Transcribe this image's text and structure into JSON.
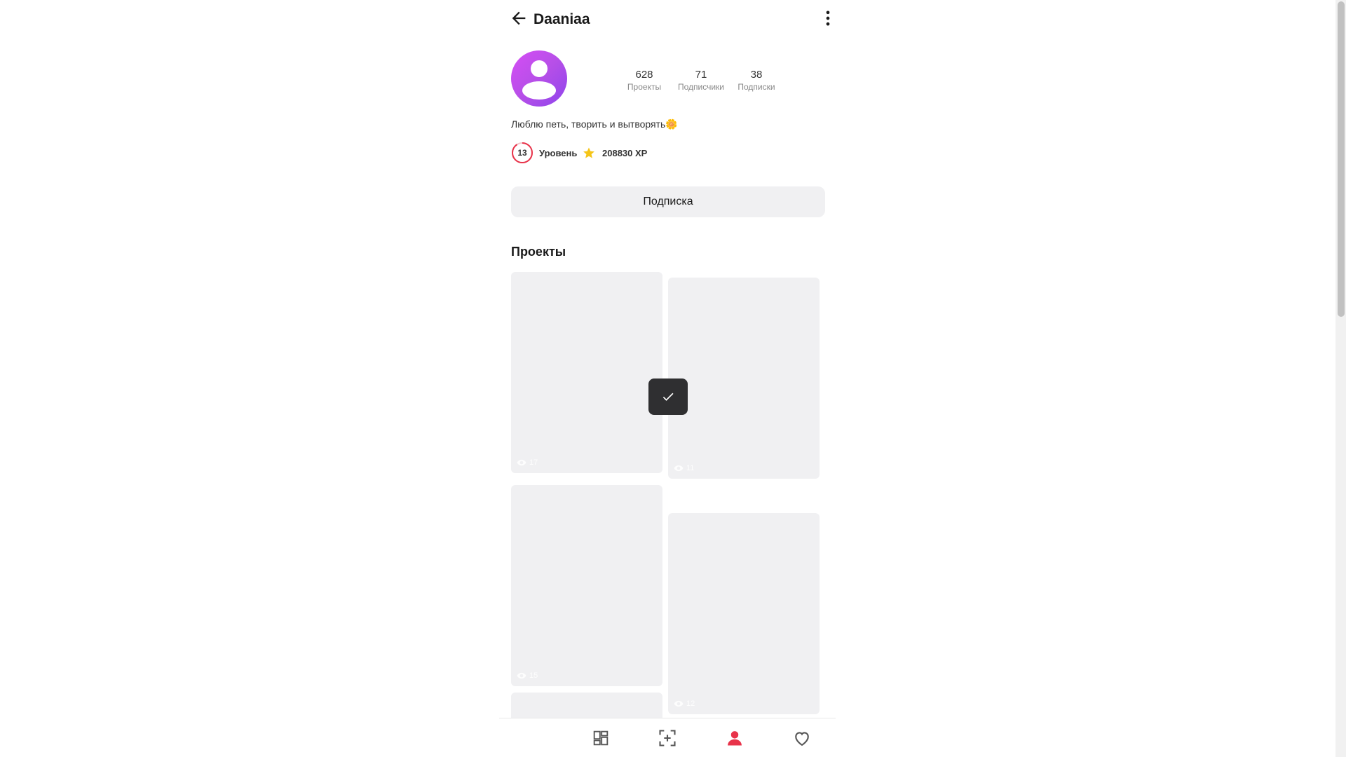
{
  "header": {
    "title": "Daaniaa",
    "back_icon": "arrow-left-icon",
    "more_icon": "more-vertical-icon"
  },
  "profile": {
    "avatar_icon": "user-avatar-icon",
    "avatar_color": "#b64fe8",
    "stats": [
      {
        "value": "628",
        "label": "Проекты"
      },
      {
        "value": "71",
        "label": "Подписчики"
      },
      {
        "value": "38",
        "label": "Подписки"
      }
    ],
    "bio": "Люблю петь, творить и вытворять🌼",
    "level": {
      "value": "13",
      "label": "Уровень",
      "ring_color": "#e8334a"
    },
    "xp": {
      "text": "208830 XP",
      "icon": "star-icon",
      "icon_color": "#f5c518"
    }
  },
  "subscribe_button": {
    "label": "Подписка"
  },
  "projects": {
    "title": "Проекты",
    "tiles": [
      {
        "views": "17"
      },
      {
        "views": "11"
      },
      {
        "views": "15"
      },
      {
        "views": "12"
      }
    ]
  },
  "toast": {
    "icon": "checkmark-icon"
  },
  "bottom_nav": {
    "items": [
      {
        "icon": "grid-icon",
        "active": false
      },
      {
        "icon": "add-frame-icon",
        "active": false
      },
      {
        "icon": "profile-icon",
        "active": true
      },
      {
        "icon": "heart-icon",
        "active": false
      }
    ],
    "active_color": "#e8334a",
    "inactive_color": "#555555"
  }
}
